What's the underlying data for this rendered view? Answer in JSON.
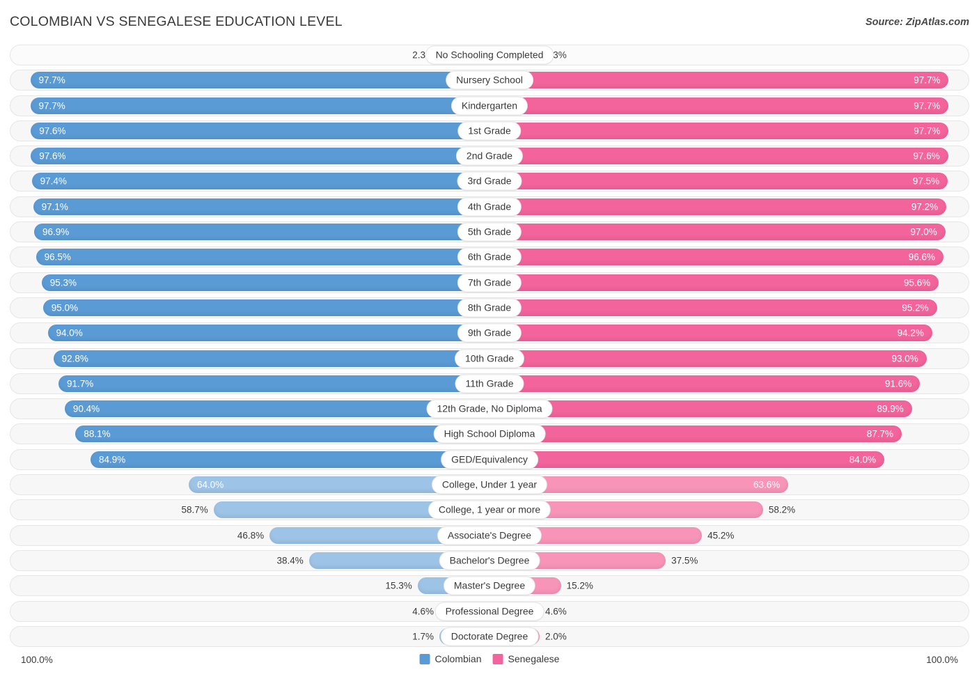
{
  "header": {
    "title": "COLOMBIAN VS SENEGALESE EDUCATION LEVEL",
    "source": "Source: ZipAtlas.com"
  },
  "legend": {
    "left_label": "Colombian",
    "right_label": "Senegalese",
    "left_color": "#5b9bd5",
    "right_color": "#f2649b"
  },
  "axis": {
    "left_max": "100.0%",
    "right_max": "100.0%"
  },
  "chart_data": {
    "type": "bar",
    "title": "COLOMBIAN VS SENEGALESE EDUCATION LEVEL",
    "orientation": "horizontal-diverging",
    "xlabel": "",
    "ylabel": "",
    "xlim": [
      0,
      100
    ],
    "grid": false,
    "legend_position": "bottom-center",
    "categories": [
      "No Schooling Completed",
      "Nursery School",
      "Kindergarten",
      "1st Grade",
      "2nd Grade",
      "3rd Grade",
      "4th Grade",
      "5th Grade",
      "6th Grade",
      "7th Grade",
      "8th Grade",
      "9th Grade",
      "10th Grade",
      "11th Grade",
      "12th Grade, No Diploma",
      "High School Diploma",
      "GED/Equivalency",
      "College, Under 1 year",
      "College, 1 year or more",
      "Associate's Degree",
      "Bachelor's Degree",
      "Master's Degree",
      "Professional Degree",
      "Doctorate Degree"
    ],
    "series": [
      {
        "name": "Colombian",
        "color": "#5b9bd5",
        "values": [
          2.3,
          97.7,
          97.7,
          97.6,
          97.6,
          97.4,
          97.1,
          96.9,
          96.5,
          95.3,
          95.0,
          94.0,
          92.8,
          91.7,
          90.4,
          88.1,
          84.9,
          64.0,
          58.7,
          46.8,
          38.4,
          15.3,
          4.6,
          1.7
        ],
        "labels": [
          "2.3%",
          "97.7%",
          "97.7%",
          "97.6%",
          "97.6%",
          "97.4%",
          "97.1%",
          "96.9%",
          "96.5%",
          "95.3%",
          "95.0%",
          "94.0%",
          "92.8%",
          "91.7%",
          "90.4%",
          "88.1%",
          "84.9%",
          "64.0%",
          "58.7%",
          "46.8%",
          "38.4%",
          "15.3%",
          "4.6%",
          "1.7%"
        ]
      },
      {
        "name": "Senegalese",
        "color": "#f2649b",
        "values": [
          2.3,
          97.7,
          97.7,
          97.7,
          97.6,
          97.5,
          97.2,
          97.0,
          96.6,
          95.6,
          95.2,
          94.2,
          93.0,
          91.6,
          89.9,
          87.7,
          84.0,
          63.6,
          58.2,
          45.2,
          37.5,
          15.2,
          4.6,
          2.0
        ],
        "labels": [
          "2.3%",
          "97.7%",
          "97.7%",
          "97.7%",
          "97.6%",
          "97.5%",
          "97.2%",
          "97.0%",
          "96.6%",
          "95.6%",
          "95.2%",
          "94.2%",
          "93.0%",
          "91.6%",
          "89.9%",
          "87.7%",
          "84.0%",
          "63.6%",
          "58.2%",
          "45.2%",
          "37.5%",
          "15.2%",
          "4.6%",
          "2.0%"
        ]
      }
    ]
  }
}
